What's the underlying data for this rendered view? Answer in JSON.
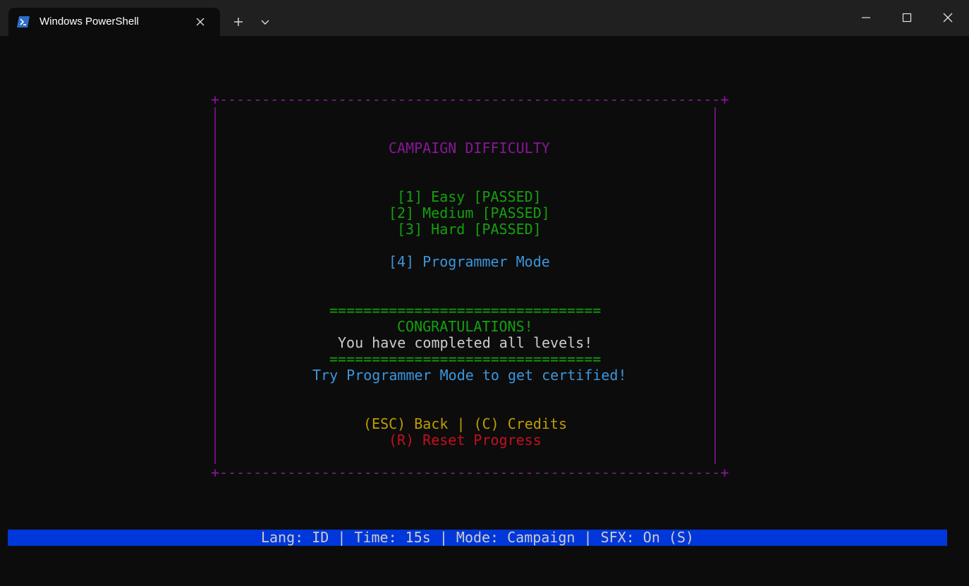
{
  "window": {
    "tab_title": "Windows PowerShell"
  },
  "menu": {
    "title": "CAMPAIGN DIFFICULTY",
    "options": [
      "[1] Easy [PASSED]",
      "[2] Medium [PASSED]",
      "[3] Hard [PASSED]",
      "[4] Programmer Mode"
    ],
    "divider_top": "================================",
    "congrats_heading": "CONGRATULATIONS!",
    "congrats_message": "You have completed all levels!",
    "divider_bottom": "================================",
    "hint": "Try Programmer Mode to get certified!",
    "nav_back_credits": "(ESC) Back | (C) Credits",
    "nav_reset": "(R) Reset Progress"
  },
  "frame": {
    "top": "+-----------------------------------------------------------+",
    "bottom": "+-----------------------------------------------------------+",
    "side": "|"
  },
  "status_bar": {
    "text": "Lang: ID | Time: 15s | Mode: Campaign | SFX: On (S)"
  },
  "colors": {
    "background": "#0c0c0c",
    "titlebar": "#202020",
    "magenta": "#881798",
    "green": "#13a10e",
    "blue": "#3a96dd",
    "white": "#cccccc",
    "yellow": "#c19c00",
    "red": "#c50f1f",
    "status_bar_bg": "#0037da"
  },
  "icons": {
    "app": "powershell-icon",
    "tab_close": "close-icon",
    "new_tab": "plus-icon",
    "tab_menu": "chevron-down-icon",
    "minimize": "minimize-icon",
    "maximize": "maximize-icon",
    "close": "close-icon"
  }
}
